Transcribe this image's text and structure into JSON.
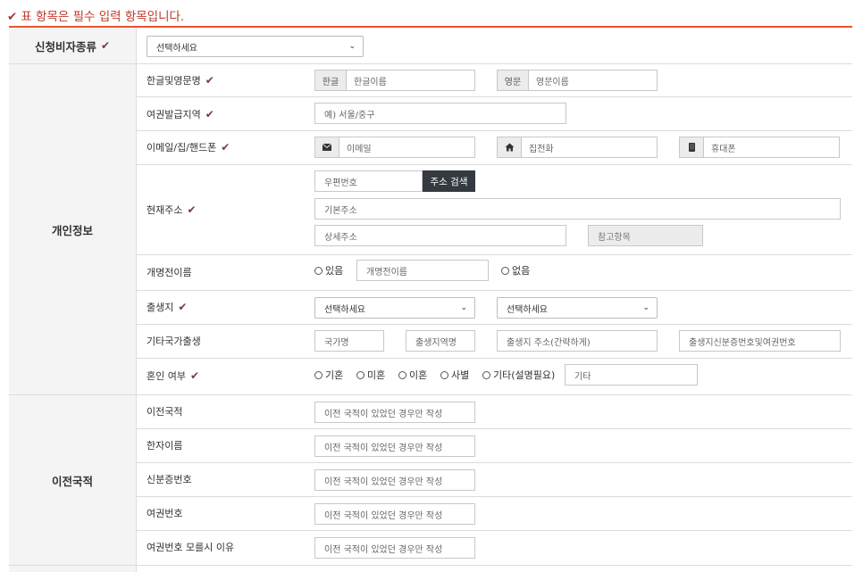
{
  "notice": {
    "check": "✔",
    "text": "표 항목은 필수 입력 항목입니다."
  },
  "sections": {
    "visa": "신청비자종류",
    "personal": "개인정보",
    "prev_nation": "이전국적"
  },
  "visa_select": "선택하세요",
  "rows": {
    "name": {
      "label": "한글및영문명",
      "kor_prefix": "한글",
      "kor_placeholder": "한글이름",
      "eng_prefix": "영문",
      "eng_placeholder": "영문이름"
    },
    "passport_region": {
      "label": "여권발급지역",
      "placeholder": "예) 서울/중구"
    },
    "contact": {
      "label": "이메일/집/핸드폰",
      "email": "이메일",
      "home": "집전화",
      "mobile": "휴대폰"
    },
    "address": {
      "label": "현재주소",
      "zip": "우편번호",
      "search_btn": "주소 검색",
      "basic": "기본주소",
      "detail": "상세주소",
      "ref": "참고항목"
    },
    "prev_name": {
      "label": "개명전이름",
      "yes": "있음",
      "placeholder": "개명전이름",
      "no": "없음"
    },
    "birthplace": {
      "label": "출생지",
      "select1": "선택하세요",
      "select2": "선택하세요"
    },
    "other_birth": {
      "label": "기타국가출생",
      "country": "국가명",
      "region": "출생지역명",
      "address": "출생지 주소(간략하게)",
      "id": "출생지신분증번호및여권번호"
    },
    "marriage": {
      "label": "혼인 여부",
      "options": [
        "기혼",
        "미혼",
        "이혼",
        "사별",
        "기타(설명필요)"
      ],
      "other_placeholder": "기타"
    }
  },
  "prev_rows": [
    {
      "label": "이전국적",
      "placeholder": "이전 국적이 있었던 경우만 작성"
    },
    {
      "label": "한자이름",
      "placeholder": "이전 국적이 있었던 경우만 작성"
    },
    {
      "label": "신분증번호",
      "placeholder": "이전 국적이 있었던 경우만 작성"
    },
    {
      "label": "여권번호",
      "placeholder": "이전 국적이 있었던 경우만 작성"
    },
    {
      "label": "여권번호 모를시 이유",
      "placeholder": "이전 국적이 있었던 경우만 작성"
    }
  ],
  "colors": {
    "accent": "#e9542f",
    "check": "#7a3b3b",
    "button": "#343a40"
  }
}
